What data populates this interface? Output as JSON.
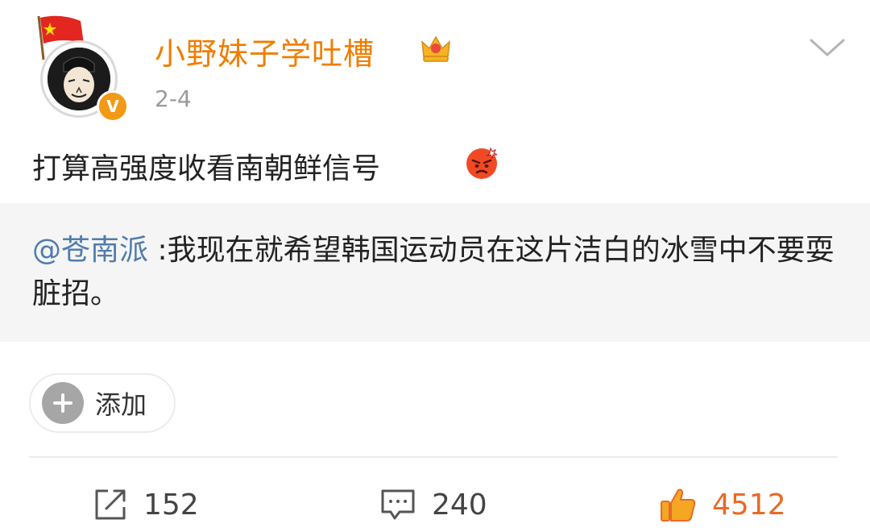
{
  "post": {
    "username": "小野妹子学吐槽",
    "date": "2-4",
    "text": "打算高强度收看南朝鲜信号",
    "verified_badge": "V",
    "username_color": "#f07d00"
  },
  "repost": {
    "mention": "@苍南派",
    "text": " :我现在就希望韩国运动员在这片洁白的冰雪中不要耍脏招。"
  },
  "add_chip": {
    "label": "添加"
  },
  "actions": {
    "repost_count": "152",
    "comment_count": "240",
    "like_count": "4512",
    "like_color": "#e86a27"
  },
  "icons": {
    "flag": "china-flag-icon",
    "crown": "crown-icon",
    "menu": "chevron-down-icon",
    "emoji": "angry-face-icon",
    "add": "plus-icon",
    "repost": "share-icon",
    "comment": "comment-icon",
    "like": "thumbs-up-icon"
  }
}
